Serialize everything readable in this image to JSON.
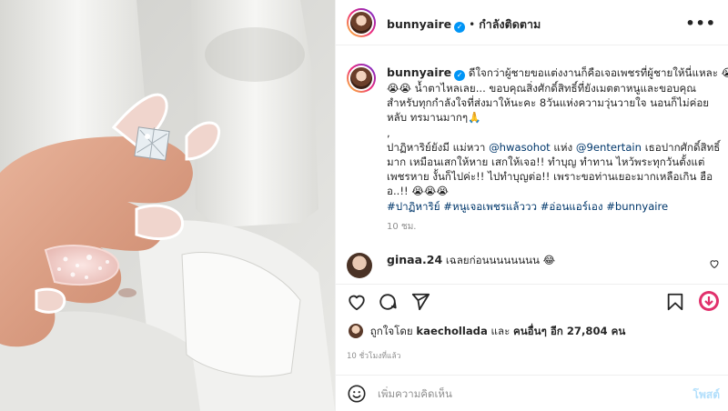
{
  "header": {
    "username": "bunnyaire",
    "follow_status": "กำลังติดตาม",
    "more_icon": "more-horizontal-icon"
  },
  "caption": {
    "username": "bunnyaire",
    "lines": [
      "ดีใจกว่าผู้ชายขอแต่งงานก็คือเจอเพชรที่ผู้ชายให้นี่แหละ 😭",
      "😭😭 น้ำตาไหลเลย... ขอบคุณสิ่งศักดิ์สิทธิ์ที่ยังเมตตาหนูและขอบคุณ",
      "สำหรับทุกกำลังใจที่ส่งมาให้นะคะ 8วันแห่งความวุ่นวายใจ นอนก็ไม่ค่อย",
      "หลับ ทรมานมากๆ🙏",
      ",",
      "ปาฏิหาริย์ยังมี แม่หวา",
      "มาก เหมือนเสกให้หาย เสกให้เจอ!! ทำบุญ ทำทาน ไหว้พระทุกวันตั้งแต่",
      "เพชรหาย งั้นก็ไปค่ะ!! ไปทำบุญต่อ!! เพราะขอท่านเยอะมากเหลือเกิน ฮือ",
      "อ..!! 😭😭😭"
    ],
    "mention_1": "@hwasohot",
    "word_by": "แห่ง",
    "mention_2": "@9entertain",
    "line6_end": "เธอปากศักดิ์สิทธิ์",
    "hashtags": "#ปาฏิหาริย์ #หนูเจอเพชรแล้ววว #อ่อนแอร์เอง #bunnyaire",
    "time_ago": "10 ชม."
  },
  "comment": {
    "username": "ginaa.24",
    "text": "เฉลยก่อนนนนนนนน 😂"
  },
  "actions": {
    "like_icon": "heart-icon",
    "comment_icon": "comment-icon",
    "share_icon": "share-icon",
    "save_icon": "bookmark-icon"
  },
  "likes": {
    "prefix": "ถูกใจโดย",
    "user": "kaechollada",
    "middle": "และ",
    "others": "คนอื่นๆ อีก 27,804 คน"
  },
  "timestamp": "10 ชั่วโมงที่แล้ว",
  "add_comment": {
    "placeholder": "เพิ่มความคิดเห็น",
    "post_label": "โพสต์",
    "emoji_icon": "emoji-icon"
  },
  "colors": {
    "link": "#00376b",
    "verified": "#0095f6",
    "muted": "#8e8e8e",
    "post_button": "#b2dffc"
  }
}
